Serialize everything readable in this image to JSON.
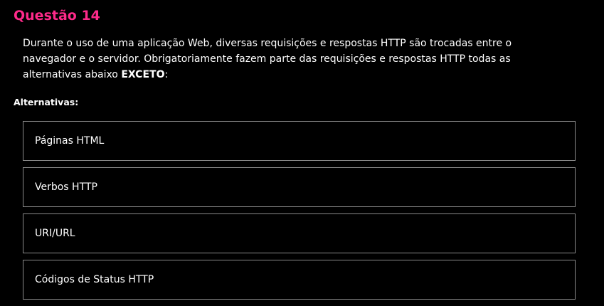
{
  "question": {
    "title": "Questão 14",
    "text_before": "Durante o uso de uma aplicação Web, diversas requisições e respostas HTTP são trocadas entre o navegador e o servidor. Obrigatoriamente fazem parte das requisições e respostas HTTP todas as alternativas abaixo ",
    "text_emphasis": "EXCETO",
    "text_after": ":"
  },
  "alternatives": {
    "label": "Alternativas:",
    "options": [
      {
        "label": "Páginas HTML"
      },
      {
        "label": "Verbos HTTP"
      },
      {
        "label": "URI/URL"
      },
      {
        "label": "Códigos de Status HTTP"
      }
    ]
  },
  "colors": {
    "title": "#ff2a8a",
    "background": "#000000",
    "text": "#ffffff",
    "option_border": "#8a8a8a"
  }
}
